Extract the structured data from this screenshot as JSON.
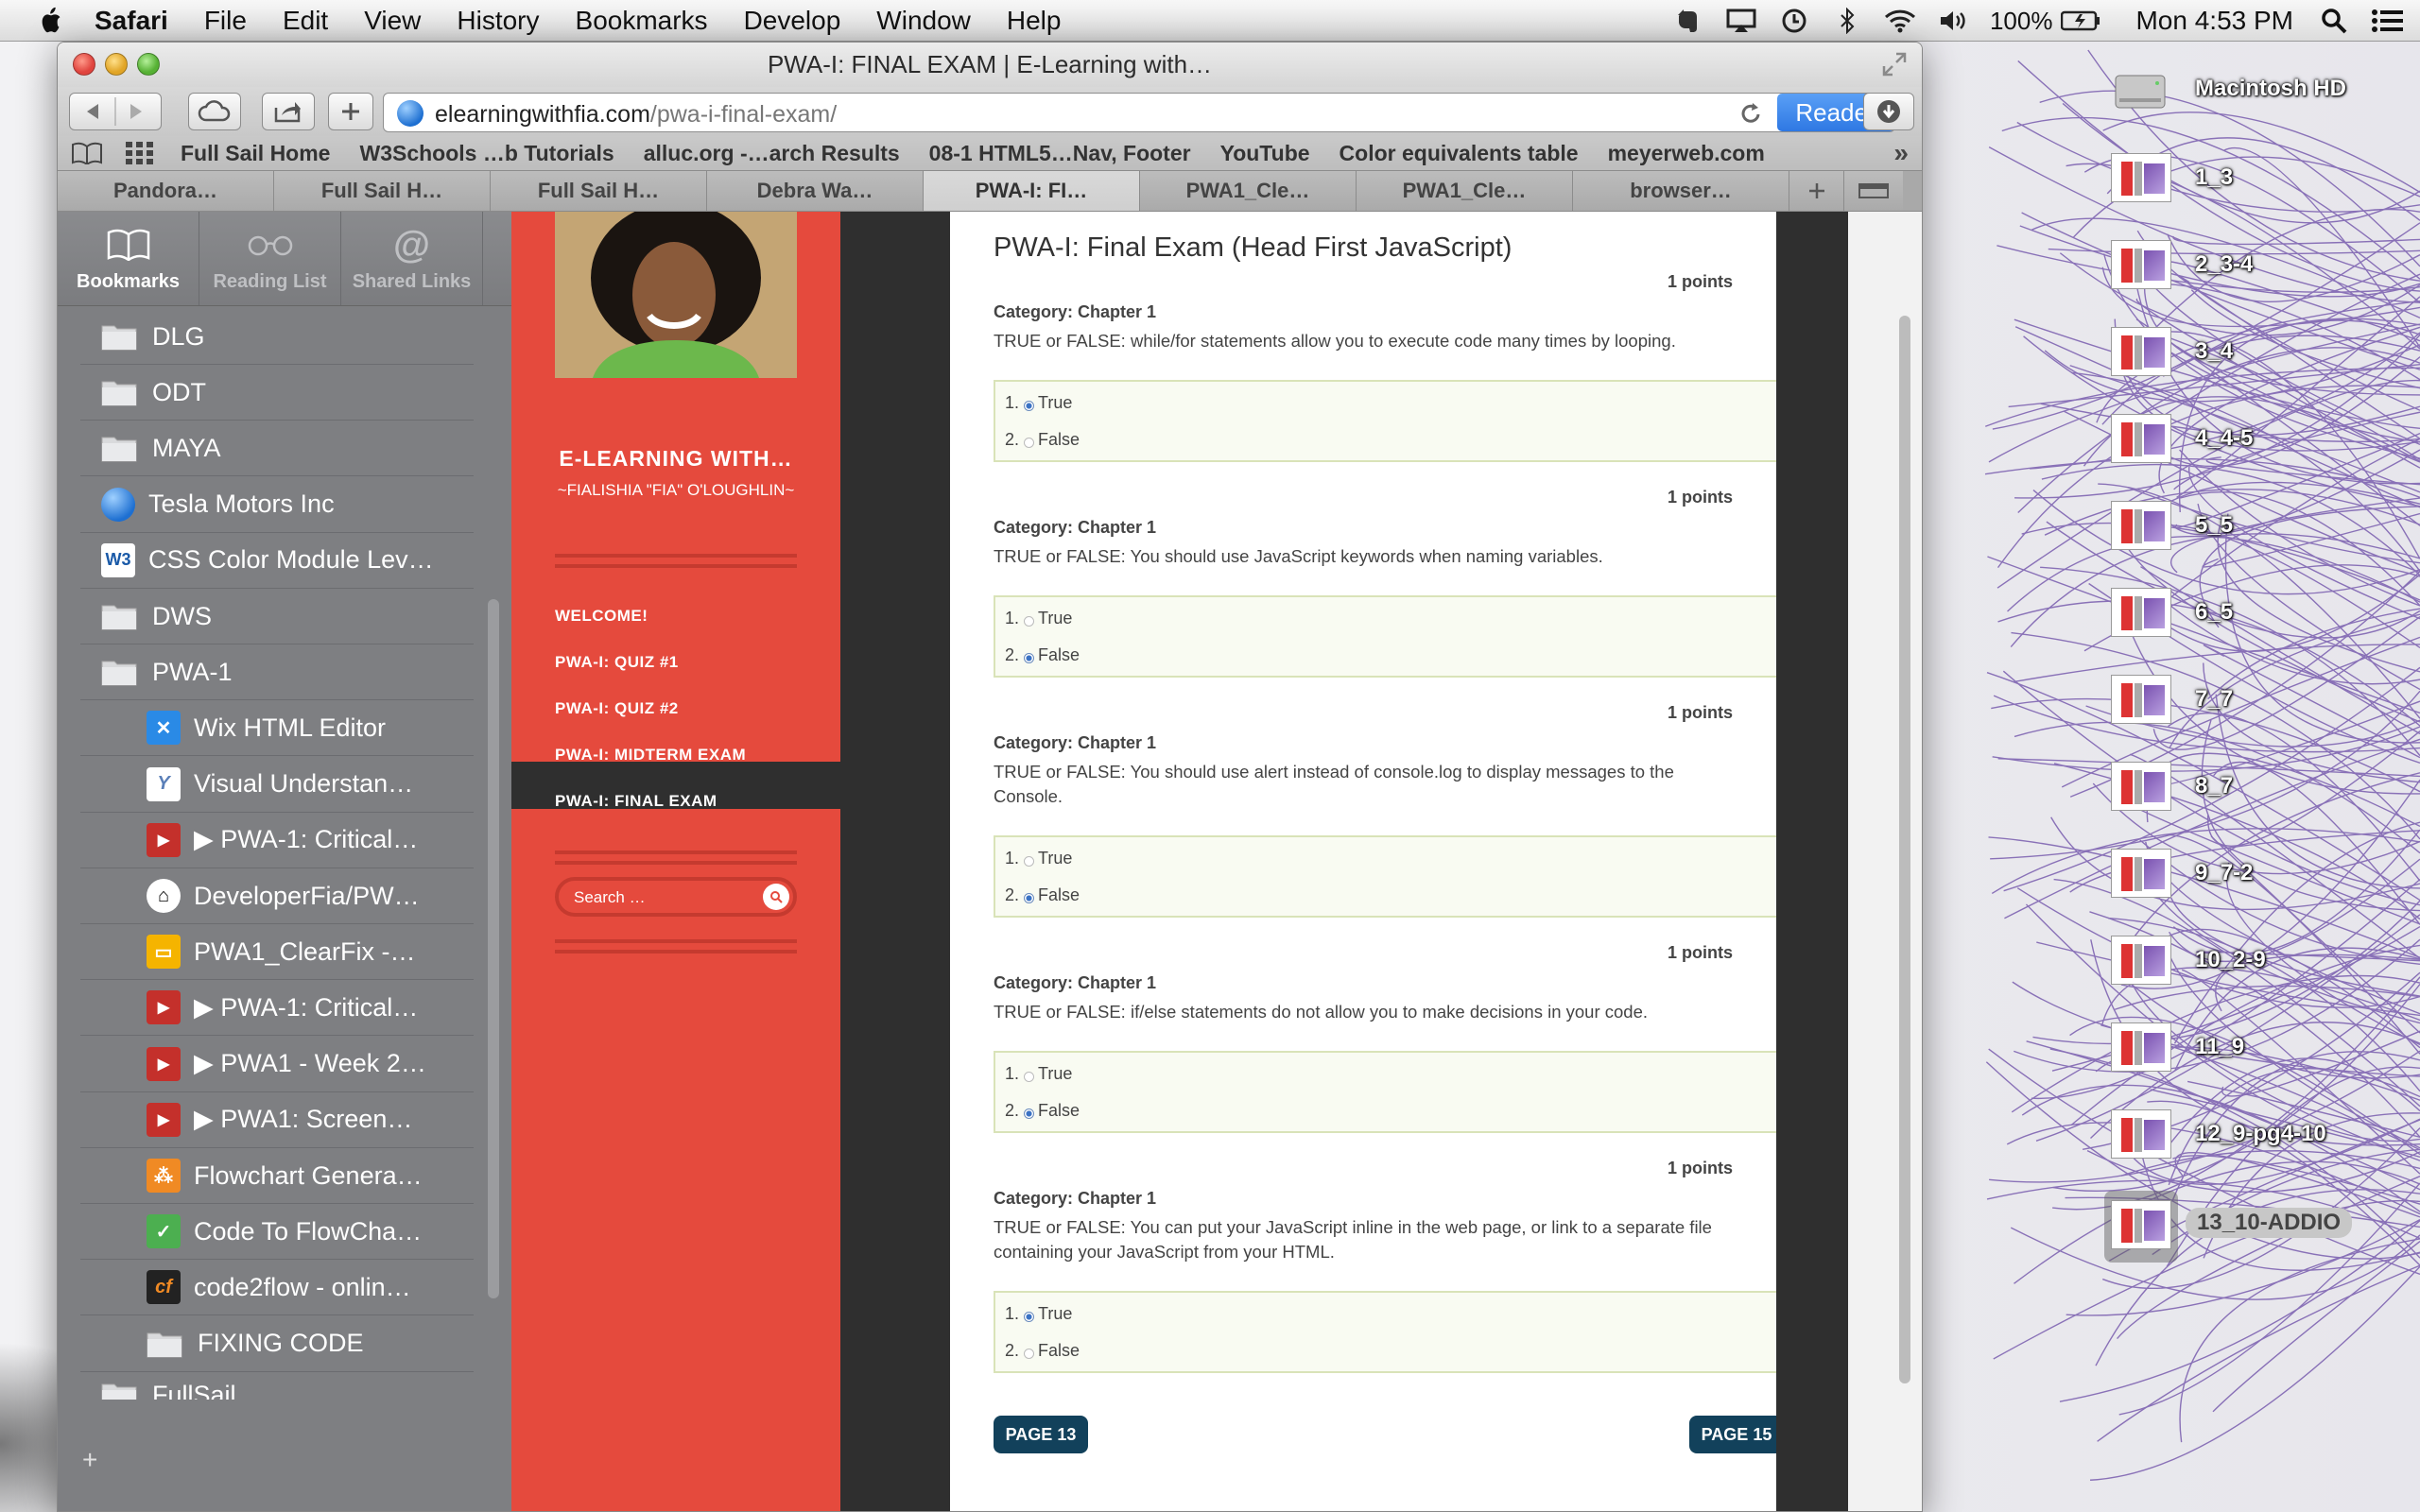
{
  "menubar": {
    "app": "Safari",
    "items": [
      "File",
      "Edit",
      "View",
      "History",
      "Bookmarks",
      "Develop",
      "Window",
      "Help"
    ],
    "battery": "100%",
    "clock": "Mon 4:53 PM"
  },
  "window": {
    "title": "PWA-I: FINAL EXAM | E-Learning with…"
  },
  "toolbar": {
    "url_domain": "elearningwithfia.com",
    "url_path": "/pwa-i-final-exam/",
    "reader": "Reader"
  },
  "bookmarks_bar": [
    "Full Sail Home",
    "W3Schools …b Tutorials",
    "alluc.org -…arch Results",
    "08-1 HTML5…Nav, Footer",
    "YouTube",
    "Color equivalents table",
    "meyerweb.com"
  ],
  "tabs": [
    "Pandora…",
    "Full Sail H…",
    "Full Sail H…",
    "Debra Wa…",
    "PWA-I: FI…",
    "PWA1_Cle…",
    "PWA1_Cle…",
    "browser…"
  ],
  "active_tab_index": 4,
  "sidebar": {
    "tabs": [
      "Bookmarks",
      "Reading List",
      "Shared Links"
    ],
    "items": [
      {
        "label": "DLG",
        "icon": "folder-icon"
      },
      {
        "label": "ODT",
        "icon": "folder-icon"
      },
      {
        "label": "MAYA",
        "icon": "folder-icon"
      },
      {
        "label": "Tesla Motors Inc",
        "icon": "globe-icon"
      },
      {
        "label": "CSS Color Module Lev…",
        "icon": "w3c-icon"
      },
      {
        "label": "DWS",
        "icon": "folder-icon"
      },
      {
        "label": "PWA-1",
        "icon": "folder-icon"
      },
      {
        "label": "Wix HTML Editor",
        "icon": "wix-icon"
      },
      {
        "label": "Visual Understan…",
        "icon": "y-icon"
      },
      {
        "label": "▶ PWA-1: Critical…",
        "icon": "youtube-icon"
      },
      {
        "label": "DeveloperFia/PW…",
        "icon": "github-icon"
      },
      {
        "label": "PWA1_ClearFix -…",
        "icon": "slides-icon"
      },
      {
        "label": "▶ PWA-1: Critical…",
        "icon": "youtube-icon"
      },
      {
        "label": "▶ PWA1 - Week 2…",
        "icon": "youtube-icon"
      },
      {
        "label": "▶ PWA1: Screen…",
        "icon": "youtube-icon"
      },
      {
        "label": "Flowchart Genera…",
        "icon": "flowchart-icon"
      },
      {
        "label": "Code To FlowCha…",
        "icon": "check-icon"
      },
      {
        "label": "code2flow - onlin…",
        "icon": "cf-icon"
      },
      {
        "label": "FIXING CODE",
        "icon": "folder-icon"
      },
      {
        "label": "FullSail",
        "icon": "folder-icon"
      }
    ],
    "add": "+"
  },
  "site": {
    "name": "E-LEARNING WITH…",
    "author": "~FIALISHIA \"FIA\" O'LOUGHLIN~",
    "nav": [
      "WELCOME!",
      "PWA-I: QUIZ #1",
      "PWA-I: QUIZ #2",
      "PWA-I: MIDTERM EXAM",
      "PWA-I: FINAL EXAM"
    ],
    "search_placeholder": "Search …"
  },
  "article": {
    "title": "PWA-I: Final Exam (Head First JavaScript)",
    "questions": [
      {
        "points": "1 points",
        "category": "Category: Chapter 1",
        "text": "TRUE or FALSE:  while/for statements allow you to execute code many times by looping.",
        "answers": [
          "True",
          "False"
        ],
        "selected": 0
      },
      {
        "points": "1 points",
        "category": "Category: Chapter 1",
        "text": "TRUE or FALSE:  You should use JavaScript keywords when naming variables.",
        "answers": [
          "True",
          "False"
        ],
        "selected": 1
      },
      {
        "points": "1 points",
        "category": "Category: Chapter 1",
        "text": "TRUE or FALSE:  You should use alert instead of console.log to display messages to the Console.",
        "answers": [
          "True",
          "False"
        ],
        "selected": 1
      },
      {
        "points": "1 points",
        "category": "Category: Chapter 1",
        "text": "TRUE or FALSE:  if/else statements do not allow you to make decisions in your code.",
        "answers": [
          "True",
          "False"
        ],
        "selected": 1
      },
      {
        "points": "1 points",
        "category": "Category: Chapter 1",
        "text": "TRUE or FALSE: You can put your JavaScript inline in the web page, or link to a separate file containing your JavaScript from your HTML.",
        "answers": [
          "True",
          "False"
        ],
        "selected": 0
      }
    ],
    "prev_page": "PAGE 13",
    "next_page": "PAGE 15"
  },
  "desktop": {
    "drive": "Macintosh HD",
    "files": [
      "1_3",
      "2_3-4",
      "3_4",
      "4_4-5",
      "5_5",
      "6_5",
      "7_7",
      "8_7",
      "9_7-2",
      "10_2-9",
      "11_9",
      "12_9-pg4-10",
      "13_10-ADDIO"
    ],
    "selected_file": "13_10-ADDIO"
  }
}
